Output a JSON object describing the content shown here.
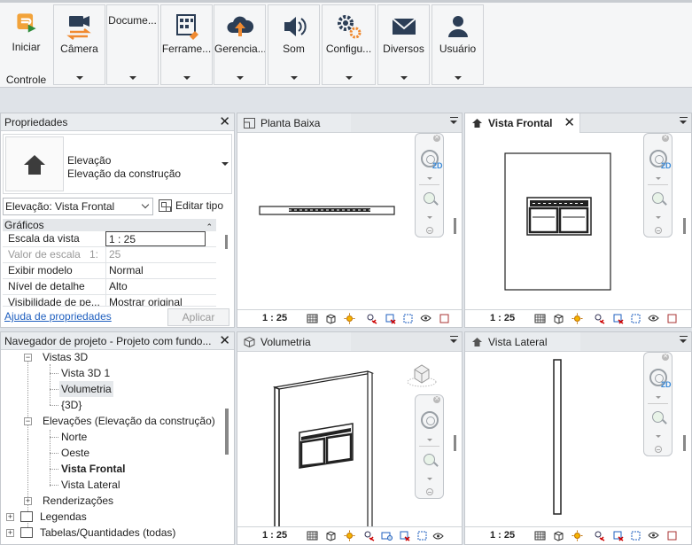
{
  "ribbon": {
    "buttons": [
      {
        "label": "Iniciar",
        "icon": "start-icon"
      },
      {
        "label": "Câmera",
        "icon": "camera-icon"
      },
      {
        "label": "Docume...",
        "icon": "document-icon"
      },
      {
        "label": "Ferrame...",
        "icon": "tools-icon"
      },
      {
        "label": "Gerencia...",
        "icon": "cloud-upload-icon"
      },
      {
        "label": "Som",
        "icon": "speaker-icon"
      },
      {
        "label": "Configu...",
        "icon": "gears-icon"
      },
      {
        "label": "Diversos",
        "icon": "envelope-icon"
      },
      {
        "label": "Usuário",
        "icon": "user-icon"
      }
    ],
    "group_label": "Controle"
  },
  "properties": {
    "title": "Propriedades",
    "type_line1": "Elevação",
    "type_line2": "Elevação da construção",
    "selector_value": "Elevação: Vista Frontal",
    "edit_type_label": "Editar tipo",
    "section": "Gráficos",
    "rows": [
      {
        "key": "Escala da vista",
        "value": "1 : 25"
      },
      {
        "key": "Valor de escala",
        "key_suffix": "1:",
        "value": "25"
      },
      {
        "key": "Exibir modelo",
        "value": "Normal"
      },
      {
        "key": "Nível de detalhe",
        "value": "Alto"
      },
      {
        "key": "Visibilidade de pe...",
        "value": "Mostrar original"
      }
    ],
    "help_link": "Ajuda de propriedades",
    "apply_label": "Aplicar"
  },
  "browser": {
    "title": "Navegador de projeto - Projeto com fundo...",
    "items": [
      {
        "label": "Vistas 3D"
      },
      {
        "label": "Vista 3D 1"
      },
      {
        "label": "Volumetria"
      },
      {
        "label": "{3D}"
      },
      {
        "label": "Elevações (Elevação da construção)"
      },
      {
        "label": "Norte"
      },
      {
        "label": "Oeste"
      },
      {
        "label": "Vista Frontal"
      },
      {
        "label": "Vista Lateral"
      },
      {
        "label": "Renderizações"
      },
      {
        "label": "Legendas"
      },
      {
        "label": "Tabelas/Quantidades (todas)"
      }
    ]
  },
  "views": [
    {
      "tab": "Planta Baixa",
      "scale": "1 : 25"
    },
    {
      "tab": "Vista Frontal",
      "scale": "1 : 25"
    },
    {
      "tab": "Volumetria",
      "scale": "1 : 25"
    },
    {
      "tab": "Vista Lateral",
      "scale": "1 : 25"
    }
  ],
  "navbar": {
    "tag": "2D"
  },
  "colors": {
    "ribbon_bg": "#f5f6f7",
    "accent_orange": "#f0a030",
    "accent_blue": "#1f5fbf",
    "icon_dark": "#2c3e56"
  }
}
